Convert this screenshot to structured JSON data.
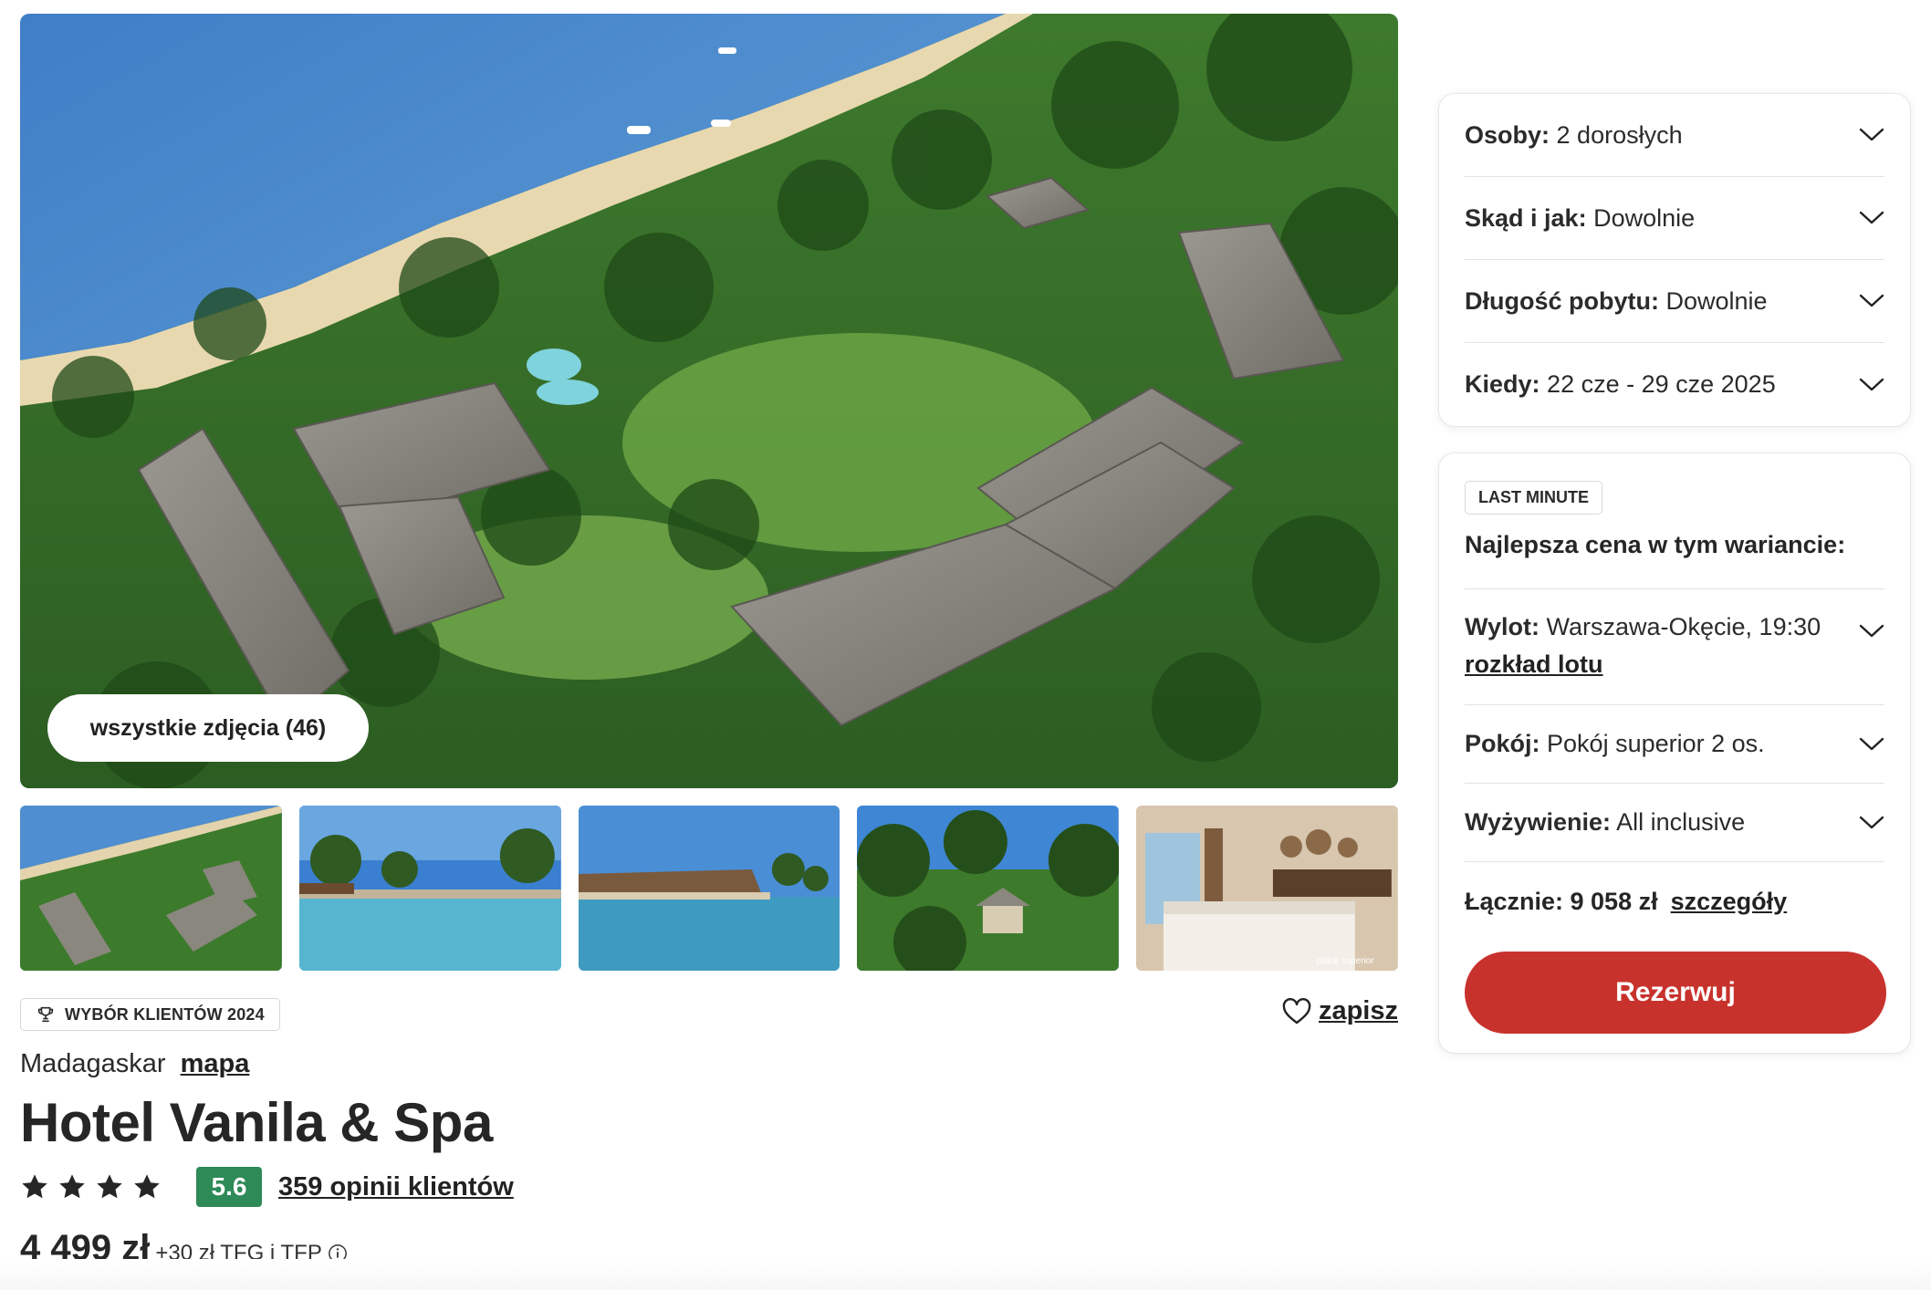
{
  "gallery": {
    "all_photos_label": "wszystkie zdjęcia (46)",
    "thumbnails": [
      {
        "icon": "aerial-resort-photo"
      },
      {
        "icon": "infinity-pool-photo"
      },
      {
        "icon": "pool-restaurant-photo"
      },
      {
        "icon": "garden-bungalow-photo"
      },
      {
        "icon": "hotel-room-photo",
        "caption": "pokój superior"
      }
    ]
  },
  "badge": {
    "label": "WYBÓR KLIENTÓW 2024",
    "icon": "trophy-icon"
  },
  "save": {
    "label": "zapisz",
    "icon": "heart-icon"
  },
  "location": {
    "country": "Madagaskar",
    "map_label": "mapa"
  },
  "hotel": {
    "name": "Hotel Vanila & Spa",
    "stars": 4,
    "score": "5.6",
    "score_color": "#2e8a57",
    "reviews_label": "359 opinii klientów"
  },
  "price": {
    "main": "4 499 zł",
    "extra": "+30 zł TFG i TFP",
    "info_icon": "info-icon"
  },
  "filters": [
    {
      "label": "Osoby:",
      "value": "2 dorosłych"
    },
    {
      "label": "Skąd i jak:",
      "value": "Dowolnie"
    },
    {
      "label": "Długość pobytu:",
      "value": "Dowolnie"
    },
    {
      "label": "Kiedy:",
      "value": "22 cze - 29 cze 2025"
    }
  ],
  "offer": {
    "badge": "LAST MINUTE",
    "heading": "Najlepsza cena w tym wariancie:",
    "flight": {
      "label": "Wylot:",
      "value": "Warszawa-Okęcie, 19:30",
      "link": "rozkład lotu"
    },
    "room": {
      "label": "Pokój:",
      "value": "Pokój superior 2 os."
    },
    "board": {
      "label": "Wyżywienie:",
      "value": "All inclusive"
    },
    "total": {
      "label": "Łącznie: 9 058 zł",
      "details": "szczegóły"
    },
    "reserve_label": "Rezerwuj",
    "accent_color": "#c8322c"
  }
}
